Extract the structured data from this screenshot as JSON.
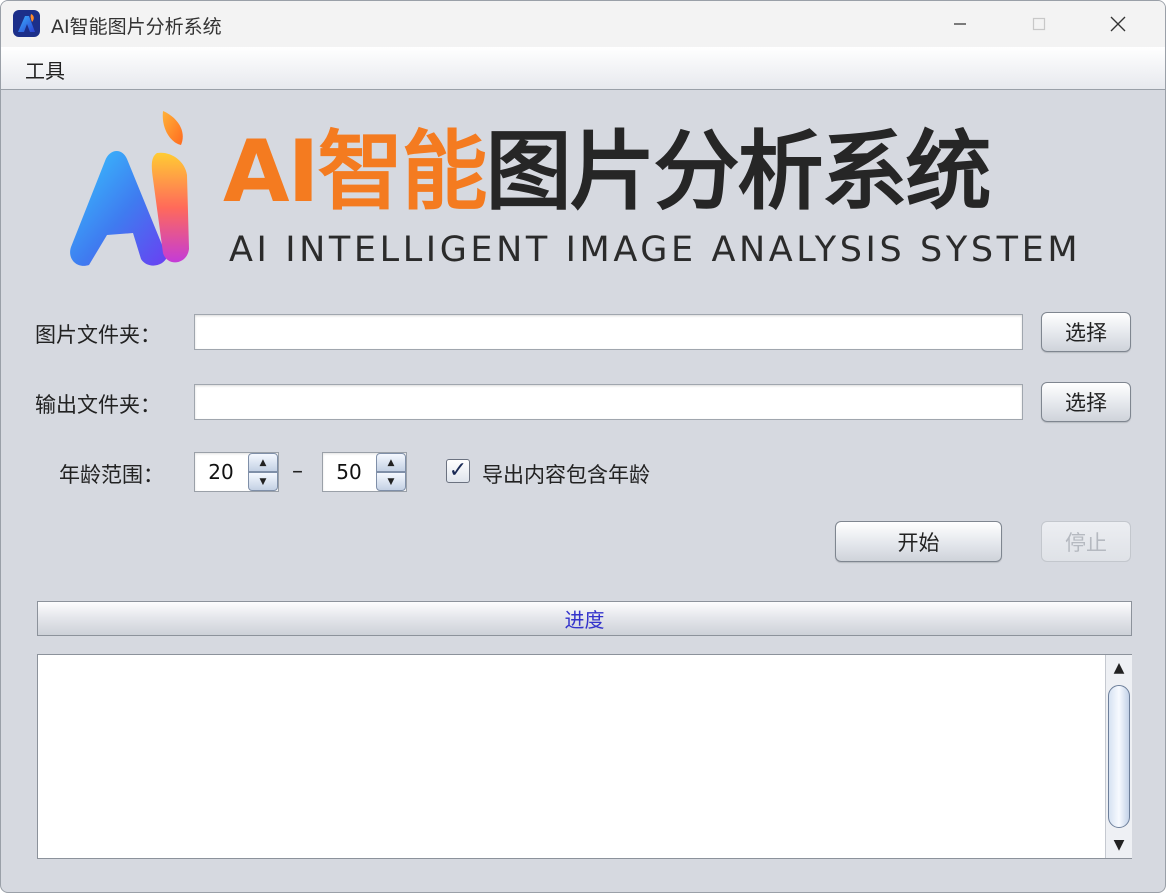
{
  "window": {
    "title": "AI智能图片分析系统",
    "controls": {
      "minimize": "minimize",
      "maximize": "maximize",
      "close": "close"
    }
  },
  "menu": {
    "items": [
      {
        "label": "工具"
      }
    ]
  },
  "logo": {
    "cn_orange": "AI智能",
    "cn_dark": "图片分析系统",
    "en": "AI INTELLIGENT IMAGE ANALYSIS SYSTEM",
    "colors": {
      "orange": "#f47b20",
      "dark": "#262626"
    }
  },
  "form": {
    "image_folder": {
      "label": "图片文件夹：",
      "value": "",
      "button": "选择"
    },
    "output_folder": {
      "label": "输出文件夹：",
      "value": "",
      "button": "选择"
    },
    "age_range": {
      "label": "年龄范围：",
      "min": "20",
      "separator": "–",
      "max": "50"
    },
    "include_age": {
      "label": "导出内容包含年龄",
      "checked": true,
      "mark": "✓"
    }
  },
  "actions": {
    "start": "开始",
    "stop": "停止",
    "stop_enabled": false
  },
  "progress": {
    "label": "进度",
    "percent": 0
  },
  "log": {
    "text": ""
  },
  "icons": {
    "app": "ai-logo-icon",
    "spin_up": "▲",
    "spin_down": "▼",
    "scroll_up": "▲",
    "scroll_down": "▼"
  }
}
